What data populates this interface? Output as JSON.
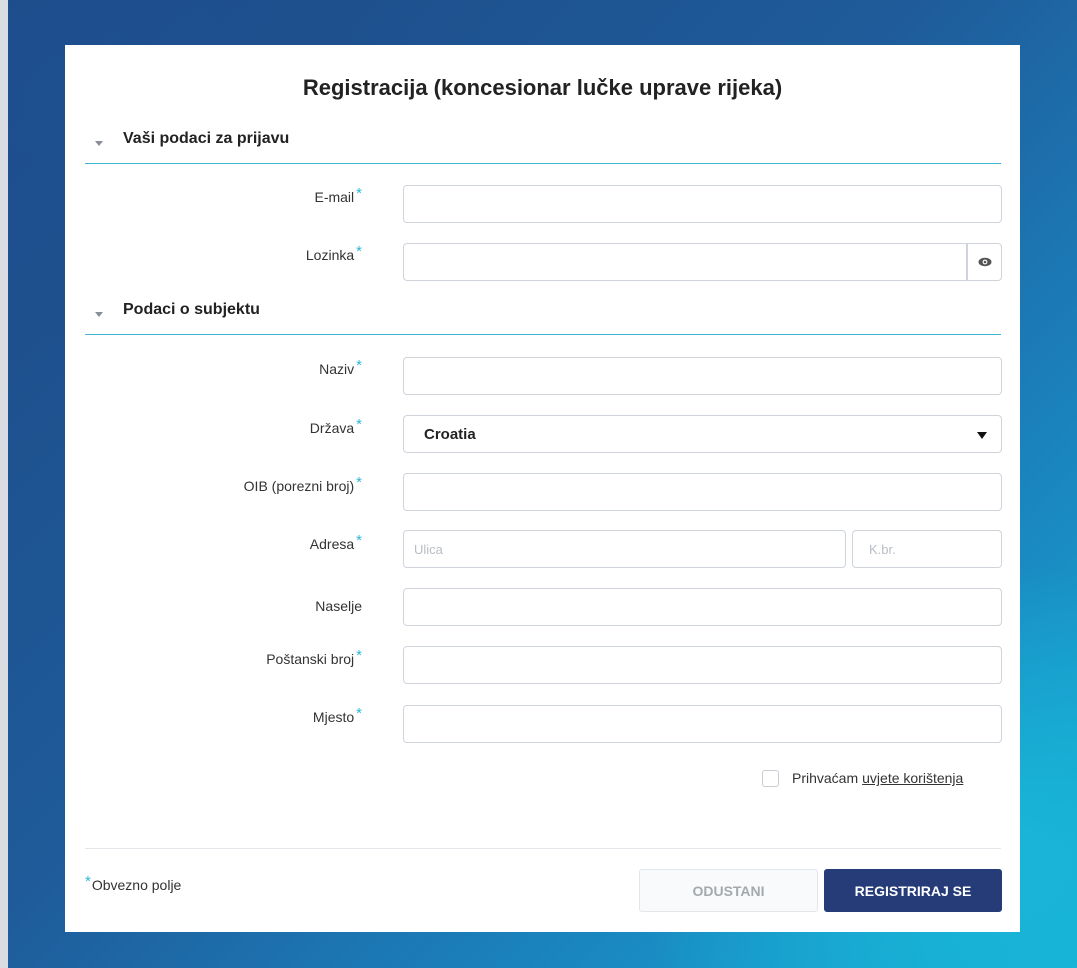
{
  "form": {
    "title": "Registracija (koncesionar lučke uprave rijeka)",
    "required_marker": "*"
  },
  "section_login": {
    "title": "Vaši podaci za prijavu",
    "email_label": "E-mail",
    "email_value": "",
    "password_label": "Lozinka",
    "password_value": "",
    "show_password_icon": "eye-icon"
  },
  "section_subject": {
    "title": "Podaci o subjektu",
    "naziv_label": "Naziv",
    "naziv_value": "",
    "drzava_label": "Država",
    "drzava_value": "Croatia",
    "oib_label": "OIB (porezni broj)",
    "oib_value": "",
    "adresa_label": "Adresa",
    "ulica_placeholder": "Ulica",
    "kbr_placeholder": "K.br.",
    "naselje_label": "Naselje",
    "naselje_value": "",
    "postanski_label": "Poštanski broj",
    "postanski_value": "",
    "mjesto_label": "Mjesto",
    "mjesto_value": ""
  },
  "terms": {
    "text": "Prihvaćam",
    "link": "uvjete korištenja",
    "checked": false
  },
  "footer": {
    "required_note": "Obvezno polje",
    "cancel_label": "ODUSTANI",
    "submit_label": "REGISTRIRAJ SE"
  },
  "colors": {
    "accent": "#2fb6d6",
    "primary_button": "#253c78"
  }
}
